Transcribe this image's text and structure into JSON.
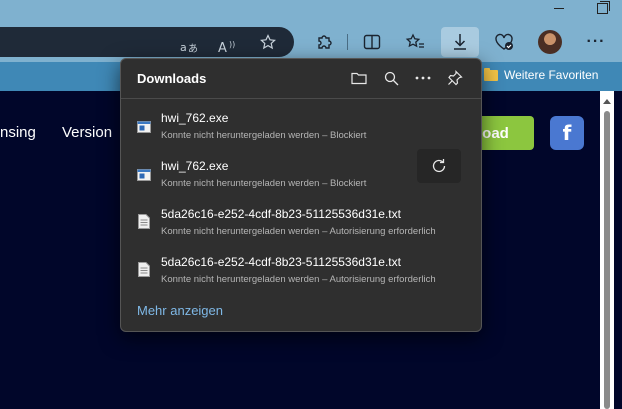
{
  "toolbar": {
    "icons": [
      "read-aloud-icon",
      "font-size-icon",
      "favorite-star-icon",
      "extensions-icon",
      "split-screen-icon",
      "favorites-icon",
      "downloads-icon",
      "health-icon",
      "profile-avatar",
      "more-options-icon"
    ],
    "more_label": "···"
  },
  "favorites_bar": {
    "folder_label": "Weitere Favoriten"
  },
  "page": {
    "nav": [
      "nsing",
      "Version"
    ],
    "download_button": "load",
    "facebook_label": "f"
  },
  "downloads": {
    "title": "Downloads",
    "items": [
      {
        "name": "hwi_762.exe",
        "status": "Konnte nicht heruntergeladen werden – Blockiert",
        "type": "exe"
      },
      {
        "name": "hwi_762.exe",
        "status": "Konnte nicht heruntergeladen werden – Blockiert",
        "type": "exe"
      },
      {
        "name": "5da26c16-e252-4cdf-8b23-51125536d31e.txt",
        "status": "Konnte nicht heruntergeladen werden – Autorisierung erforderlich",
        "type": "txt"
      },
      {
        "name": "5da26c16-e252-4cdf-8b23-51125536d31e.txt",
        "status": "Konnte nicht heruntergeladen werden – Autorisierung erforderlich",
        "type": "txt"
      }
    ],
    "show_more": "Mehr anzeigen"
  }
}
